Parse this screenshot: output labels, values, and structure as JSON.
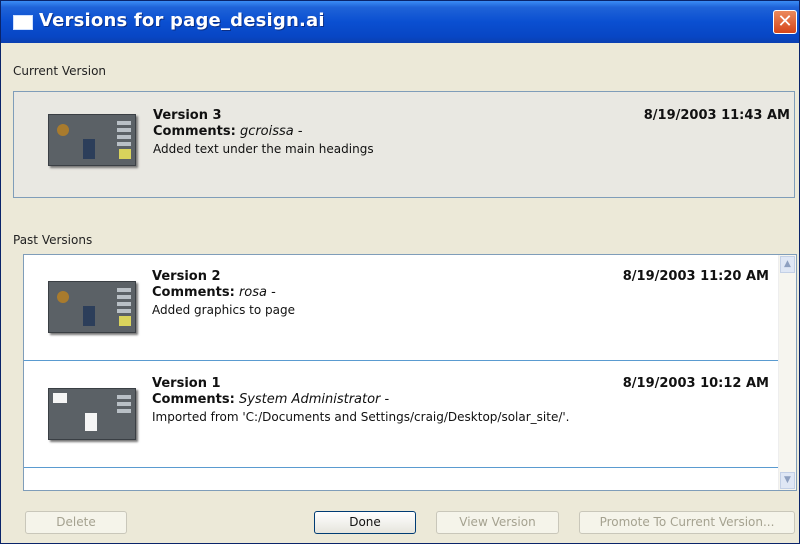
{
  "window": {
    "title": "Versions for page_design.ai",
    "close_glyph": "✕"
  },
  "current_section": {
    "label": "Current Version",
    "item": {
      "title": "Version 3",
      "comments_label": "Comments:",
      "author": "gcroissa",
      "separator": "-",
      "description": "Added text under the main headings",
      "date": "8/19/2003 11:43 AM"
    }
  },
  "past_section": {
    "label": "Past Versions",
    "items": [
      {
        "title": "Version 2",
        "comments_label": "Comments:",
        "author": "rosa",
        "separator": "-",
        "description": "Added graphics to page",
        "date": "8/19/2003 11:20 AM"
      },
      {
        "title": "Version 1",
        "comments_label": "Comments:",
        "author": "System Administrator",
        "separator": "-",
        "description": "Imported from 'C:/Documents and Settings/craig/Desktop/solar_site/'.",
        "date": "8/19/2003 10:12 AM"
      }
    ],
    "scroll_up_glyph": "▲",
    "scroll_down_glyph": "▼"
  },
  "buttons": {
    "delete": "Delete",
    "done": "Done",
    "view_version": "View Version",
    "promote": "Promote To Current Version..."
  },
  "icons": {
    "window_icon": "window-icon",
    "close_icon": "close-icon",
    "thumbnail": "page-thumbnail"
  },
  "colors": {
    "title_bar": "#0a4fd1",
    "dialog_bg": "#ece9d8",
    "list_border": "#7f9db9",
    "row_divider": "#5a9bd0",
    "close_button": "#d6451a"
  }
}
